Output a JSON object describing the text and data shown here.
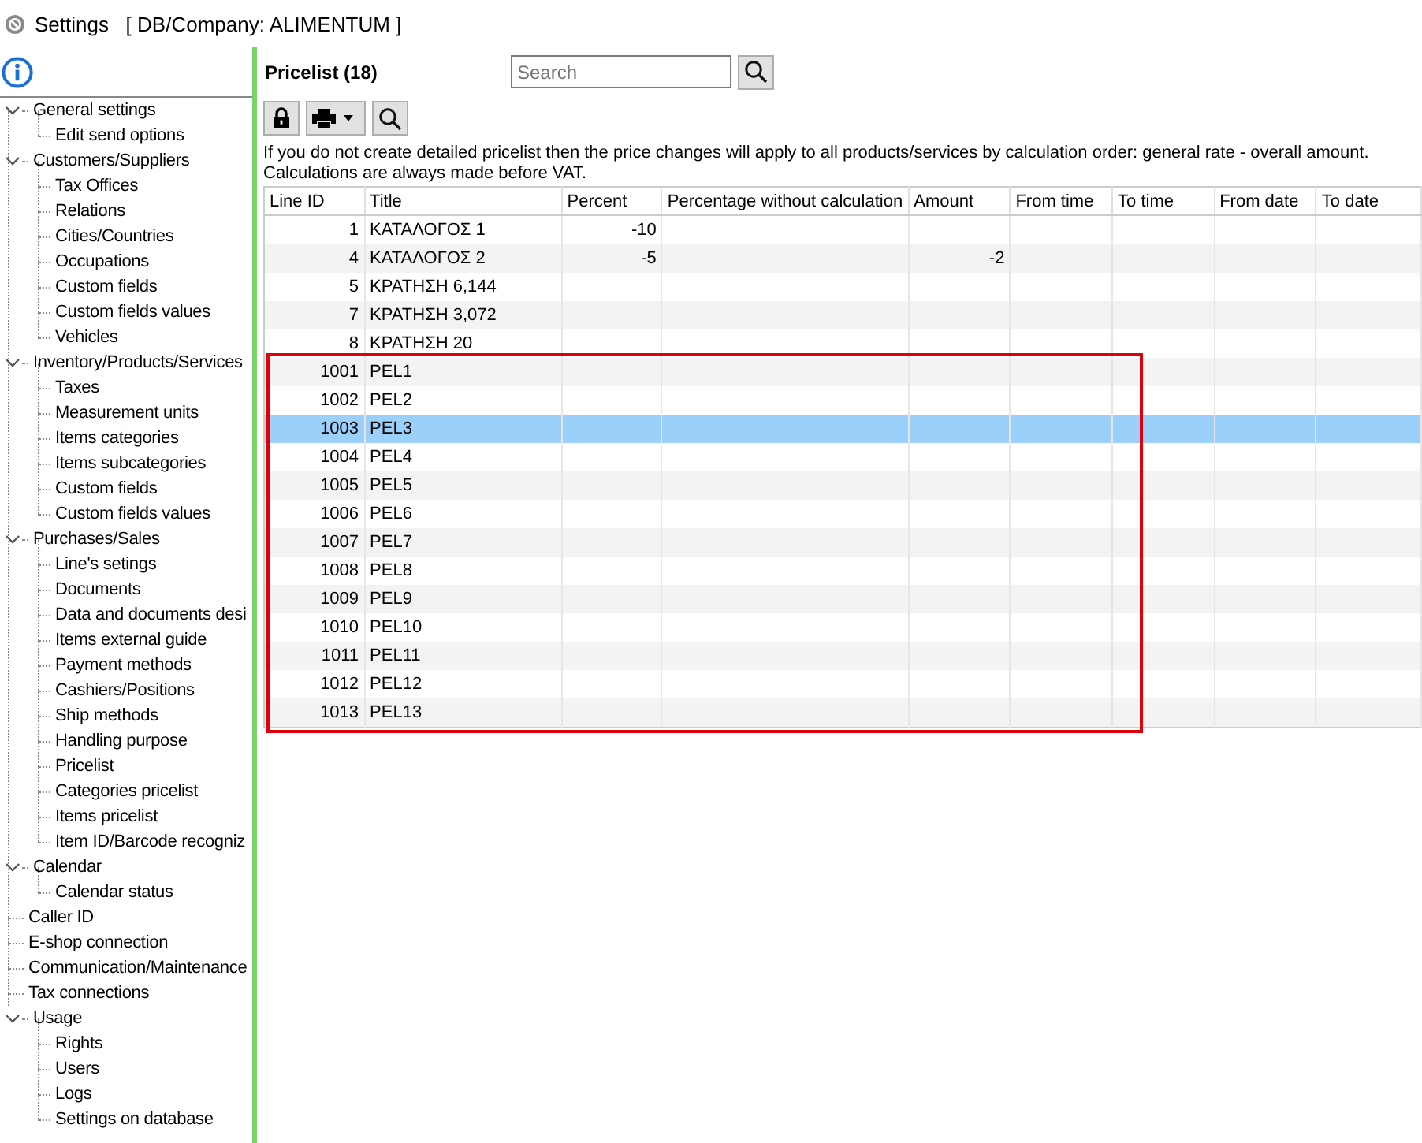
{
  "window": {
    "title": "Settings",
    "subtitle": "[ DB/Company: ALIMENTUM ]"
  },
  "sidebar": {
    "items": [
      {
        "label": "General settings",
        "expanded": true,
        "children": [
          {
            "label": "Edit send options"
          }
        ]
      },
      {
        "label": "Customers/Suppliers",
        "expanded": true,
        "children": [
          {
            "label": "Tax Offices"
          },
          {
            "label": "Relations"
          },
          {
            "label": "Cities/Countries"
          },
          {
            "label": "Occupations"
          },
          {
            "label": "Custom fields"
          },
          {
            "label": "Custom fields values"
          },
          {
            "label": "Vehicles"
          }
        ]
      },
      {
        "label": "Inventory/Products/Services",
        "expanded": true,
        "children": [
          {
            "label": "Taxes"
          },
          {
            "label": "Measurement units"
          },
          {
            "label": "Items categories"
          },
          {
            "label": "Items subcategories"
          },
          {
            "label": "Custom fields"
          },
          {
            "label": "Custom fields values"
          }
        ]
      },
      {
        "label": "Purchases/Sales",
        "expanded": true,
        "children": [
          {
            "label": "Line's setings"
          },
          {
            "label": "Documents"
          },
          {
            "label": "Data and documents desi"
          },
          {
            "label": "Items external guide"
          },
          {
            "label": "Payment methods"
          },
          {
            "label": "Cashiers/Positions"
          },
          {
            "label": "Ship methods"
          },
          {
            "label": "Handling purpose"
          },
          {
            "label": "Pricelist"
          },
          {
            "label": "Categories pricelist"
          },
          {
            "label": "Items pricelist"
          },
          {
            "label": "Item ID/Barcode recogniz"
          }
        ]
      },
      {
        "label": "Calendar",
        "expanded": true,
        "children": [
          {
            "label": "Calendar status"
          }
        ]
      },
      {
        "label": "Caller ID"
      },
      {
        "label": "E-shop connection"
      },
      {
        "label": "Communication/Maintenance"
      },
      {
        "label": "Tax connections"
      },
      {
        "label": "Usage",
        "expanded": true,
        "children": [
          {
            "label": "Rights"
          },
          {
            "label": "Users"
          },
          {
            "label": "Logs"
          },
          {
            "label": "Settings on database"
          }
        ]
      }
    ]
  },
  "header": {
    "title": "Pricelist (18)",
    "search": {
      "placeholder": "Search"
    }
  },
  "notice": [
    "If you do not create detailed pricelist then the price changes will apply to all products/services by calculation order: general rate - overall amount.",
    "Calculations are always made before VAT."
  ],
  "table": {
    "columns": [
      "Line ID",
      "Title",
      "Percent",
      "Percentage without calculation",
      "Amount",
      "From time",
      "To time",
      "From date",
      "To date"
    ],
    "rows": [
      {
        "line_id": "1",
        "title": "ΚΑΤΑΛΟΓΟΣ 1",
        "percent": "-10",
        "selected": false,
        "highlighted": false
      },
      {
        "line_id": "4",
        "title": "ΚΑΤΑΛΟΓΟΣ 2",
        "percent": "-5",
        "amount": "-2",
        "selected": false,
        "highlighted": false
      },
      {
        "line_id": "5",
        "title": "ΚΡΑΤΗΣΗ 6,144",
        "selected": false,
        "highlighted": false
      },
      {
        "line_id": "7",
        "title": "ΚΡΑΤΗΣΗ 3,072",
        "selected": false,
        "highlighted": false
      },
      {
        "line_id": "8",
        "title": "ΚΡΑΤΗΣΗ 20",
        "selected": false,
        "highlighted": false
      },
      {
        "line_id": "1001",
        "title": "PEL1",
        "selected": false,
        "highlighted": true
      },
      {
        "line_id": "1002",
        "title": "PEL2",
        "selected": false,
        "highlighted": true
      },
      {
        "line_id": "1003",
        "title": "PEL3",
        "selected": true,
        "highlighted": true
      },
      {
        "line_id": "1004",
        "title": "PEL4",
        "selected": false,
        "highlighted": true
      },
      {
        "line_id": "1005",
        "title": "PEL5",
        "selected": false,
        "highlighted": true
      },
      {
        "line_id": "1006",
        "title": "PEL6",
        "selected": false,
        "highlighted": true
      },
      {
        "line_id": "1007",
        "title": "PEL7",
        "selected": false,
        "highlighted": true
      },
      {
        "line_id": "1008",
        "title": "PEL8",
        "selected": false,
        "highlighted": true
      },
      {
        "line_id": "1009",
        "title": "PEL9",
        "selected": false,
        "highlighted": true
      },
      {
        "line_id": "1010",
        "title": "PEL10",
        "selected": false,
        "highlighted": true
      },
      {
        "line_id": "1011",
        "title": "PEL11",
        "selected": false,
        "highlighted": true
      },
      {
        "line_id": "1012",
        "title": "PEL12",
        "selected": false,
        "highlighted": true
      },
      {
        "line_id": "1013",
        "title": "PEL13",
        "selected": false,
        "highlighted": true
      }
    ]
  }
}
